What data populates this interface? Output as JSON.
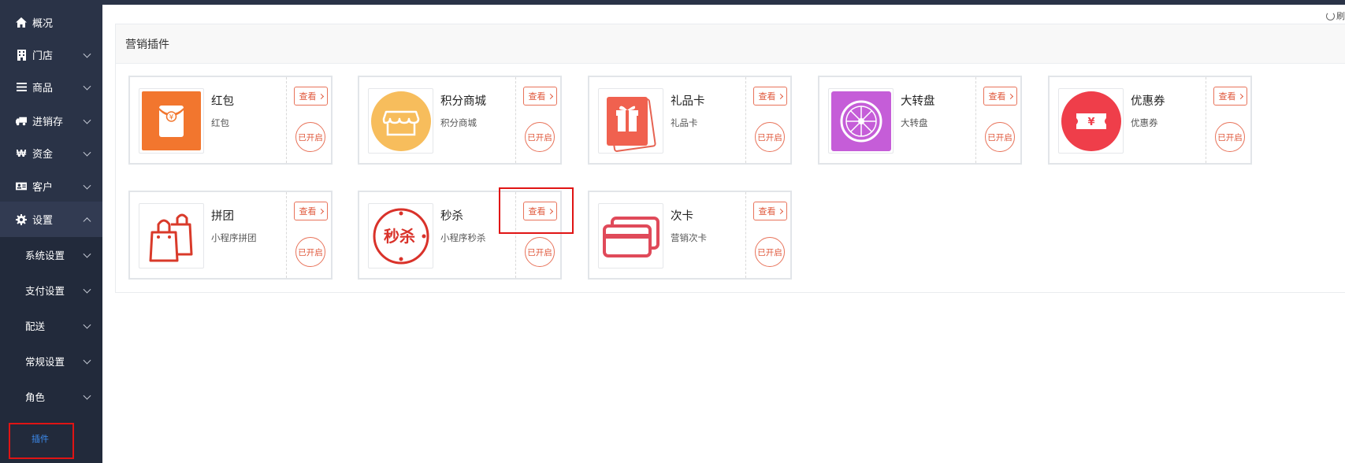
{
  "sidebar": {
    "items": [
      {
        "label": "概况"
      },
      {
        "label": "门店"
      },
      {
        "label": "商品"
      },
      {
        "label": "进销存"
      },
      {
        "label": "资金"
      },
      {
        "label": "客户"
      },
      {
        "label": "设置"
      }
    ],
    "settings_sub": [
      {
        "label": "系统设置"
      },
      {
        "label": "支付设置"
      },
      {
        "label": "配送"
      },
      {
        "label": "常规设置"
      },
      {
        "label": "角色"
      },
      {
        "label": "插件"
      }
    ]
  },
  "topbar": {
    "refresh_label": "刷"
  },
  "panel": {
    "title": "营销插件"
  },
  "plugins": [
    {
      "name": "红包",
      "desc": "红包",
      "view_label": "查看",
      "status": "已开启"
    },
    {
      "name": "积分商城",
      "desc": "积分商城",
      "view_label": "查看",
      "status": "已开启"
    },
    {
      "name": "礼品卡",
      "desc": "礼品卡",
      "view_label": "查看",
      "status": "已开启"
    },
    {
      "name": "大转盘",
      "desc": "大转盘",
      "view_label": "查看",
      "status": "已开启"
    },
    {
      "name": "优惠券",
      "desc": "优惠券",
      "view_label": "查看",
      "status": "已开启"
    },
    {
      "name": "拼团",
      "desc": "小程序拼团",
      "view_label": "查看",
      "status": "已开启"
    },
    {
      "name": "秒杀",
      "desc": "小程序秒杀",
      "view_label": "查看",
      "status": "已开启"
    },
    {
      "name": "次卡",
      "desc": "营销次卡",
      "view_label": "查看",
      "status": "已开启"
    }
  ],
  "icons": {
    "hongbao_text": "¥",
    "coupon_text": "¥",
    "miaosha_text": "秒杀"
  },
  "colors": {
    "sidebar": "#2a3347",
    "accent": "#e05a3e",
    "highlight": "#e01414",
    "active_link": "#3d8cf0"
  }
}
